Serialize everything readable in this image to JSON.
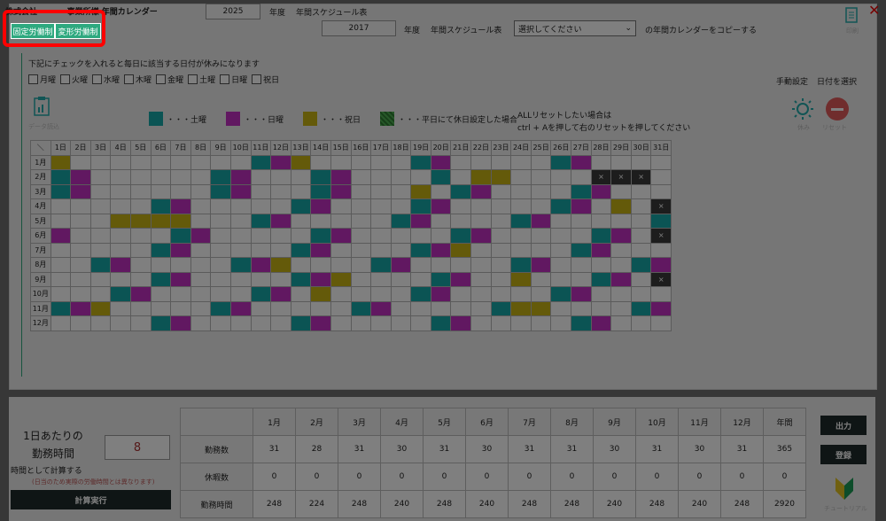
{
  "header": {
    "company": "株式会社",
    "company_suffix": "事業所様 年間カレンダー",
    "year_value": "2025",
    "year_label": "年度",
    "title": "年間スケジュール表",
    "copy_year_value": "2017",
    "copy_year_label": "年度",
    "copy_title": "年間スケジュール表",
    "copy_select": "選択してください",
    "copy_suffix": "の年間カレンダーをコピーする",
    "print_label": "印刷"
  },
  "tabs": {
    "fixed": "固定労働制",
    "variable": "変形労働制"
  },
  "instruction": "下記にチェックを入れると毎日に該当する日付が休みになります",
  "weekday_checks": [
    "月曜",
    "火曜",
    "水曜",
    "木曜",
    "金曜",
    "土曜",
    "日曜",
    "祝日"
  ],
  "manual": {
    "label": "手動設定",
    "date_select": "日付を選択"
  },
  "legend": {
    "sat": "・・・土曜",
    "sun": "・・・日曜",
    "holiday": "・・・祝日",
    "weekday_off": "・・・平日にて休日設定した場合",
    "colors": {
      "sat": "#17a9a9",
      "sun": "#c230c2",
      "holiday": "#c8b514",
      "weekday_off": "#4caf50"
    }
  },
  "notes": {
    "reset_line1": "ALLリセットしたい場合は",
    "reset_line2": "ctrl + Aを押して右のリセットを押してください"
  },
  "icons": {
    "left_label": "データ読込",
    "rest": "休み",
    "reset": "リセット"
  },
  "calendar": {
    "corner": "＼",
    "days": [
      "1日",
      "2日",
      "3日",
      "4日",
      "5日",
      "6日",
      "7日",
      "8日",
      "9日",
      "10日",
      "11日",
      "12日",
      "13日",
      "14日",
      "15日",
      "16日",
      "17日",
      "18日",
      "19日",
      "20日",
      "21日",
      "22日",
      "23日",
      "24日",
      "25日",
      "26日",
      "27日",
      "28日",
      "29日",
      "30日",
      "31日"
    ],
    "months": [
      "1月",
      "2月",
      "3月",
      "4月",
      "5月",
      "6月",
      "7月",
      "8月",
      "9月",
      "10月",
      "11月",
      "12月"
    ],
    "x_mark": "×",
    "cells": [
      "y.........tmy.....tm.....tm.....",
      "tm......tm...tm....t.yy....xxx",
      "tm......tm...tm...y.tm....tm.",
      ".....tm.....tm....tm.....tm.y.x",
      "...yyyy...tm.....tm....tm.....t",
      "m.....tm.....tm.....tm.....tm.x",
      ".....tm.....tm....tmy.....tm...",
      "..tm.....tmy....tm.....tm....tm",
      ".....tm.....tmy....tm..y...tm.x",
      "...tm.....tm.y....tm.....tm....",
      "tmy.....tm.....tm.....tyy....tm",
      ".....tm.....tm.....tm.....tm..."
    ]
  },
  "summary": {
    "title_line1": "1日あたりの",
    "title_line2": "勤務時間",
    "hours_value": "8",
    "calc_note": "時間として計算する",
    "calc_subnote": "(日当のため実際の労働時間とは異なります)",
    "calc_button": "計算実行",
    "headers": [
      "1月",
      "2月",
      "3月",
      "4月",
      "5月",
      "6月",
      "7月",
      "8月",
      "9月",
      "10月",
      "11月",
      "12月",
      "年間"
    ],
    "rows": [
      {
        "label": "勤務数",
        "values": [
          "31",
          "28",
          "31",
          "30",
          "31",
          "30",
          "31",
          "31",
          "30",
          "31",
          "30",
          "31",
          "365"
        ]
      },
      {
        "label": "休暇数",
        "values": [
          "0",
          "0",
          "0",
          "0",
          "0",
          "0",
          "0",
          "0",
          "0",
          "0",
          "0",
          "0",
          "0"
        ]
      },
      {
        "label": "勤務時間",
        "values": [
          "248",
          "224",
          "248",
          "240",
          "248",
          "240",
          "248",
          "248",
          "240",
          "248",
          "240",
          "248",
          "2920"
        ]
      }
    ]
  },
  "buttons": {
    "output": "出力",
    "register": "登録",
    "tutorial": "チュートリアル"
  }
}
